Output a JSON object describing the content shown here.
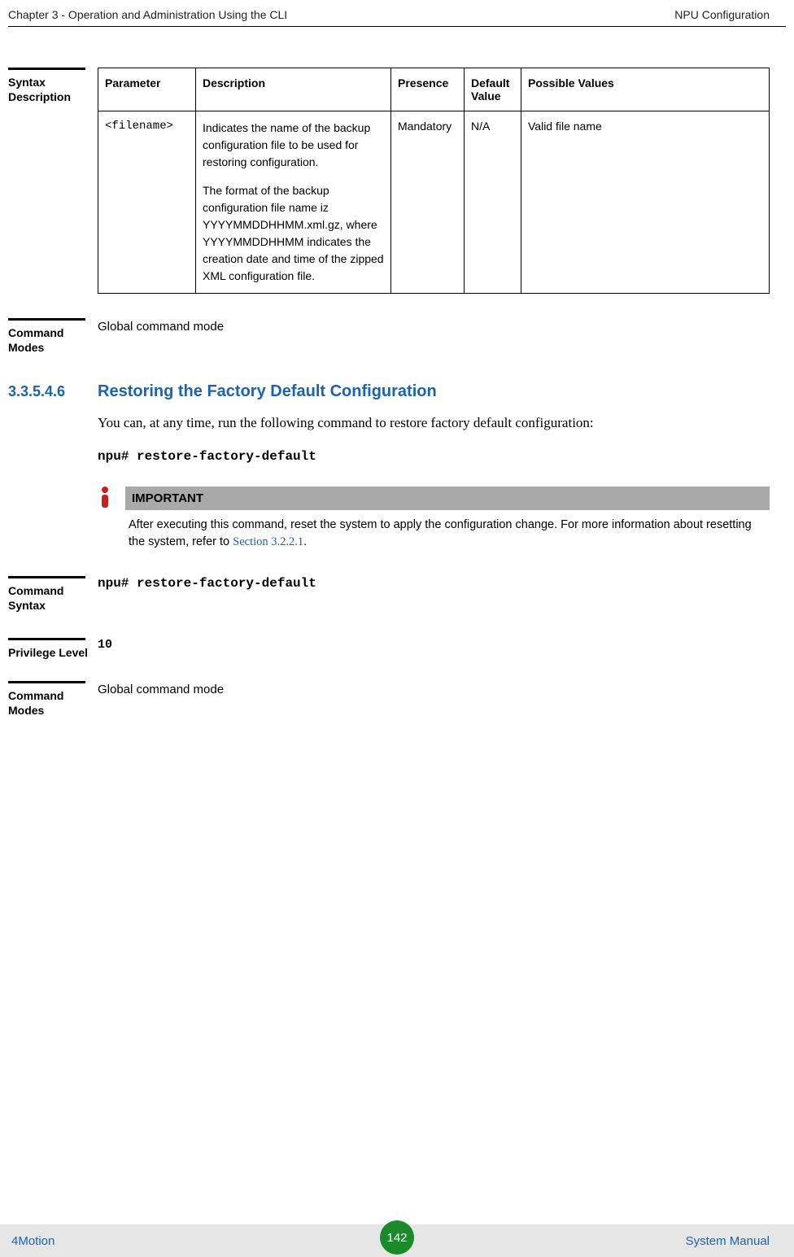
{
  "header": {
    "left": "Chapter 3 - Operation and Administration Using the CLI",
    "right": "NPU Configuration"
  },
  "syntax_description": {
    "label": "Syntax Description",
    "headers": {
      "parameter": "Parameter",
      "description": "Description",
      "presence": "Presence",
      "default_value": "Default Value",
      "possible_values": "Possible Values"
    },
    "row": {
      "parameter": "<filename>",
      "description_p1": "Indicates the name of the backup configuration file to be used for restoring configuration.",
      "description_p2": "The format of the backup configuration file name iz YYYYMMDDHHMM.xml.gz, where YYYYMMDDHHMM indicates the creation date and time of the zipped XML configuration file.",
      "presence": "Mandatory",
      "default_value": "N/A",
      "possible_values": "Valid file name"
    }
  },
  "command_modes_1": {
    "label": "Command Modes",
    "value": "Global command mode"
  },
  "section": {
    "number": "3.3.5.4.6",
    "title": "Restoring the Factory Default Configuration",
    "paragraph": "You can, at any time, run the following command to restore factory default configuration:",
    "command": "npu# restore-factory-default"
  },
  "important": {
    "label": "IMPORTANT",
    "text_before": "After executing this command, reset the system to apply the configuration change. For more information about resetting the system, refer to ",
    "link": "Section 3.2.2.1",
    "text_after": "."
  },
  "command_syntax": {
    "label": "Command Syntax",
    "value": "npu# restore-factory-default"
  },
  "privilege_level": {
    "label": "Privilege Level",
    "value": "10"
  },
  "command_modes_2": {
    "label": "Command Modes",
    "value": "Global command mode"
  },
  "footer": {
    "left": "4Motion",
    "page": "142",
    "right": "System Manual"
  }
}
